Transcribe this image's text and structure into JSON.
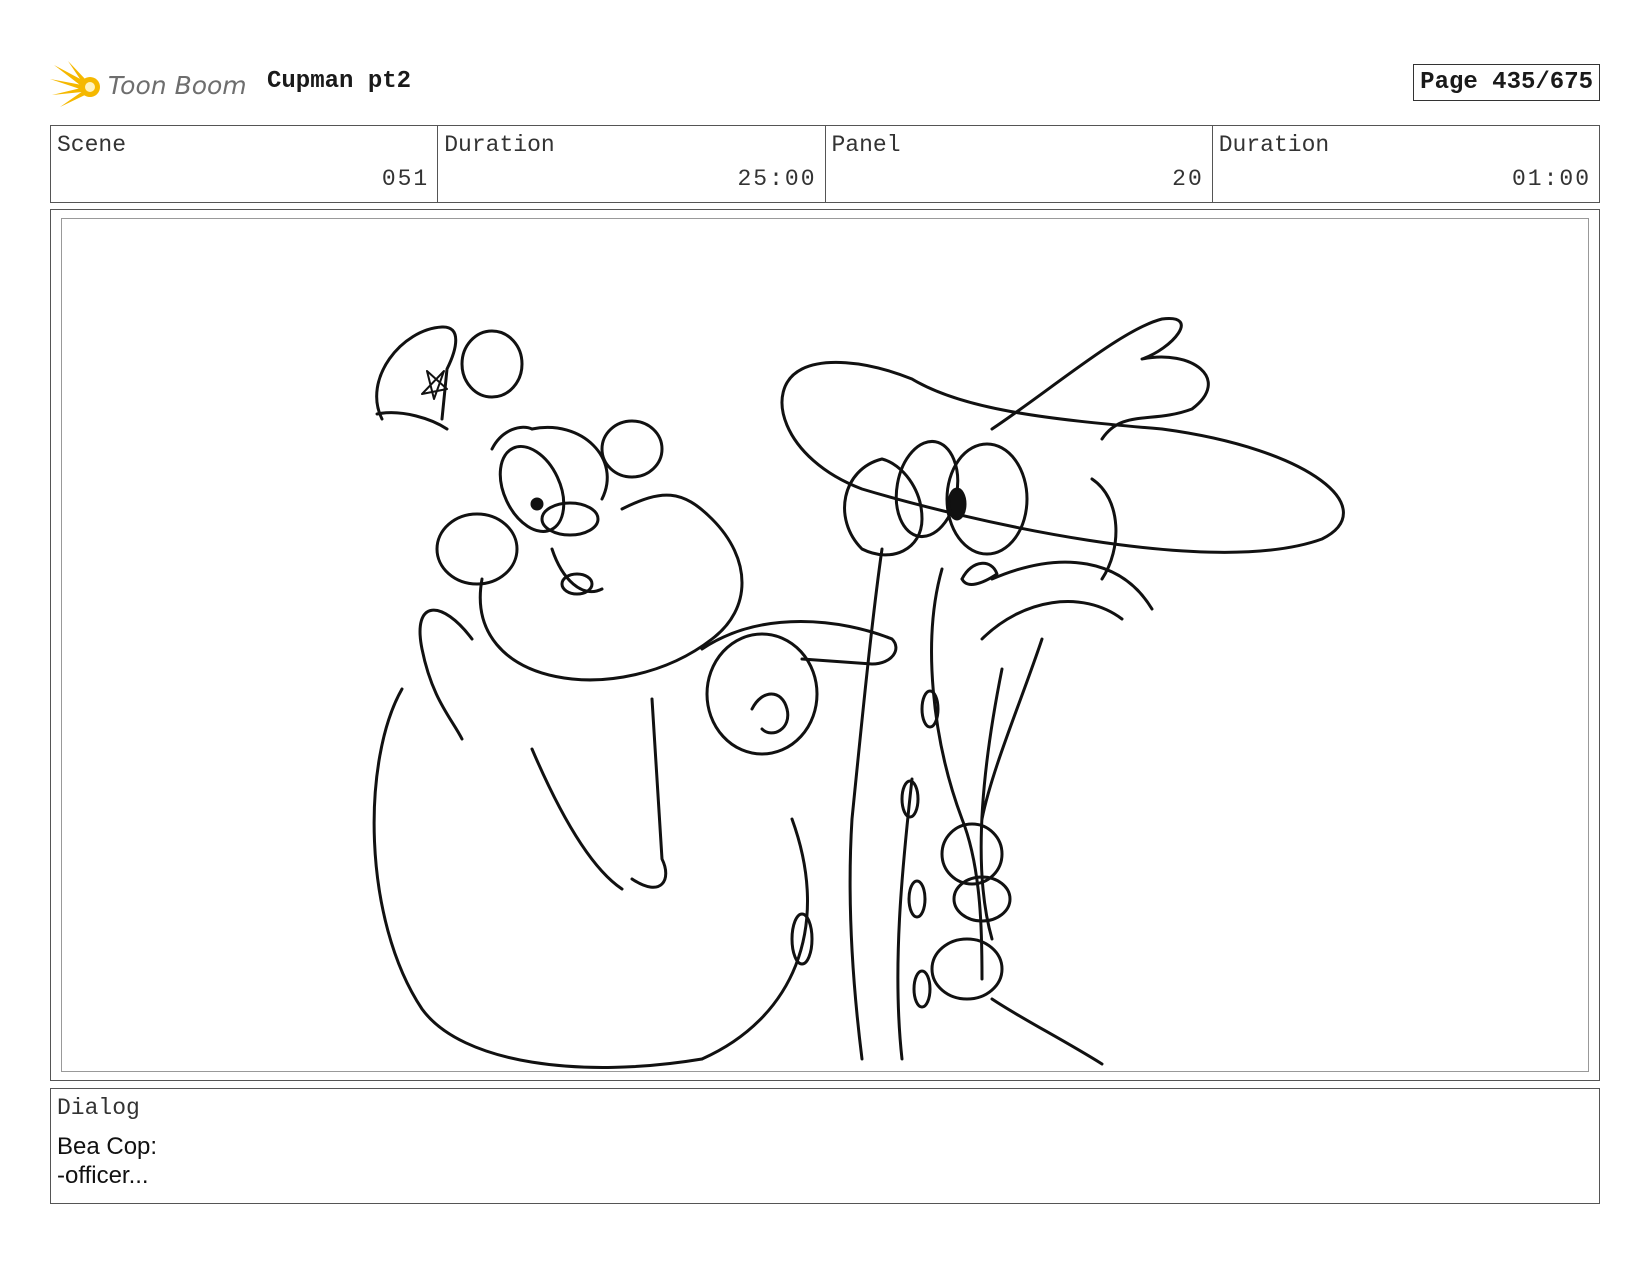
{
  "header": {
    "logo_text": "Toon Boom",
    "project_title": "Cupman pt2",
    "page": "Page 435/675"
  },
  "info": [
    {
      "label": "Scene",
      "value": "051"
    },
    {
      "label": "Duration",
      "value": "25:00"
    },
    {
      "label": "Panel",
      "value": "20"
    },
    {
      "label": "Duration",
      "value": "01:00"
    }
  ],
  "dialog": {
    "label": "Dialog",
    "lines": [
      "Bea Cop:",
      "-officer..."
    ]
  },
  "colors": {
    "logo_yellow": "#f5b800",
    "logo_text": "#6e6e6e",
    "border": "#555555"
  }
}
